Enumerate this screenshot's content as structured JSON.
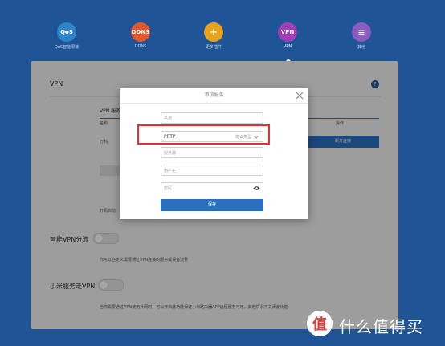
{
  "nav": [
    {
      "key": "qos",
      "circle": "QoS",
      "label": "QoS智能限速",
      "color": "#2e84c9",
      "active": false
    },
    {
      "key": "ddns",
      "circle": "DDNS",
      "label": "DDNS",
      "color": "#e2572b",
      "active": false
    },
    {
      "key": "more",
      "circle": "+",
      "label": "更多插件",
      "color": "#e8a21e",
      "active": false
    },
    {
      "key": "vpn",
      "circle": "VPN",
      "label": "VPN",
      "color": "#a23fb8",
      "active": true
    },
    {
      "key": "other",
      "circle": "≡",
      "label": "其他",
      "color": "#8b5cc2",
      "active": false
    }
  ],
  "panel": {
    "title": "VPN",
    "vpn_list_label": "VPN 服务",
    "col_name": "名称",
    "col_action": "操作",
    "row_name": "万科",
    "disconnect_label": "断开连接",
    "autostart_label": "开机启动",
    "smart_title": "智能VPN分流",
    "smart_desc": "你可以自定义需要通过VPN连接的服务或设备流量",
    "mi_title": "小米服务走VPN",
    "mi_desc": "当你需要通过VPN使用外网时，可以开启此功能保证小米路由器APP远程服务可用，其他情况下关闭此功能"
  },
  "modal": {
    "title": "添加服务",
    "name_placeholder": "名称",
    "protocol_value": "PPTP",
    "protocol_hint": "协议类型",
    "server_placeholder": "服务器",
    "user_placeholder": "用户名",
    "password_placeholder": "密码",
    "save_label": "保存"
  },
  "watermark": {
    "logo_char": "值",
    "text": "什么值得买"
  },
  "colors": {
    "background": "#1f5597",
    "primary": "#2a6fc0",
    "highlight": "#e03030"
  }
}
